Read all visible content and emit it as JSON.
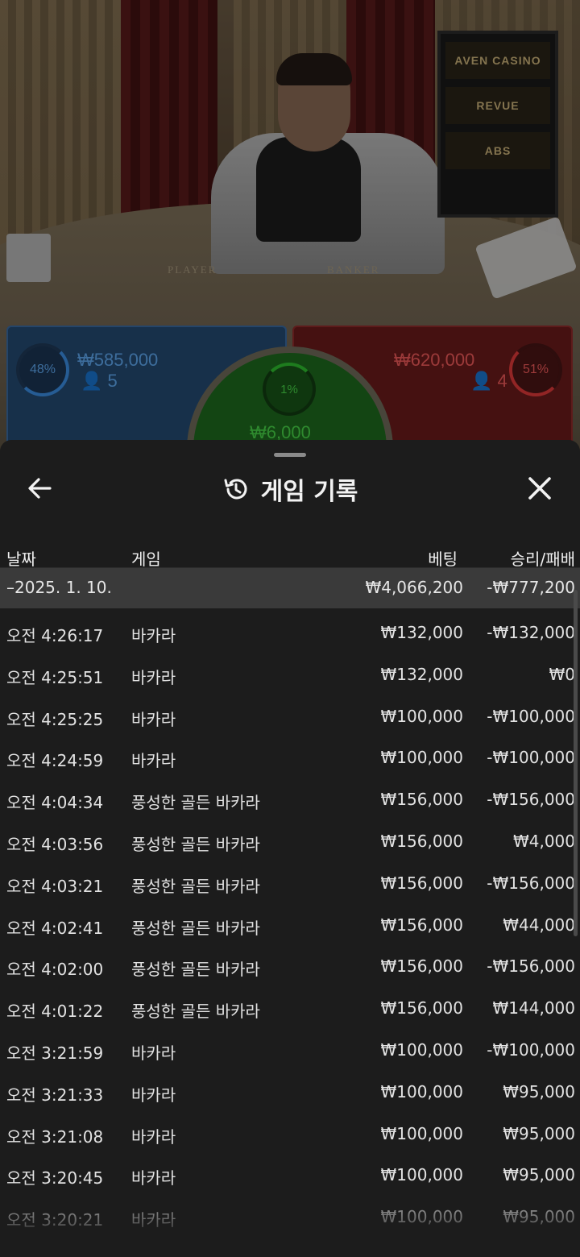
{
  "video": {
    "sponsors": [
      "AVEN CASINO",
      "REVUE",
      "ABS"
    ],
    "table_labels": {
      "player": "PLAYER",
      "banker": "BANKER"
    }
  },
  "bets": {
    "player": {
      "percent": "48%",
      "amount": "₩585,000",
      "players": "5",
      "color": "#3b8ee3"
    },
    "banker": {
      "percent": "51%",
      "amount": "₩620,000",
      "players": "4",
      "color": "#e03a3a"
    },
    "tie": {
      "percent": "1%",
      "amount": "₩6,000",
      "color": "#2fbf2f"
    }
  },
  "history": {
    "title": "게임 기록",
    "icons": {
      "back": "arrow-left-icon",
      "title": "history-icon",
      "close": "close-icon"
    },
    "columns": {
      "date": "날짜",
      "game": "게임",
      "bet": "베팅",
      "result": "승리/패배"
    },
    "day": {
      "label": "–2025. 1. 10.",
      "bet": "₩4,066,200",
      "result": "-₩777,200"
    },
    "rows": [
      {
        "time": "오전 4:26:17",
        "game": "바카라",
        "bet": "₩132,000",
        "result": "-₩132,000"
      },
      {
        "time": "오전 4:25:51",
        "game": "바카라",
        "bet": "₩132,000",
        "result": "₩0"
      },
      {
        "time": "오전 4:25:25",
        "game": "바카라",
        "bet": "₩100,000",
        "result": "-₩100,000"
      },
      {
        "time": "오전 4:24:59",
        "game": "바카라",
        "bet": "₩100,000",
        "result": "-₩100,000"
      },
      {
        "time": "오전 4:04:34",
        "game": "풍성한 골든 바카라",
        "bet": "₩156,000",
        "result": "-₩156,000"
      },
      {
        "time": "오전 4:03:56",
        "game": "풍성한 골든 바카라",
        "bet": "₩156,000",
        "result": "₩4,000"
      },
      {
        "time": "오전 4:03:21",
        "game": "풍성한 골든 바카라",
        "bet": "₩156,000",
        "result": "-₩156,000"
      },
      {
        "time": "오전 4:02:41",
        "game": "풍성한 골든 바카라",
        "bet": "₩156,000",
        "result": "₩44,000"
      },
      {
        "time": "오전 4:02:00",
        "game": "풍성한 골든 바카라",
        "bet": "₩156,000",
        "result": "-₩156,000"
      },
      {
        "time": "오전 4:01:22",
        "game": "풍성한 골든 바카라",
        "bet": "₩156,000",
        "result": "₩144,000"
      },
      {
        "time": "오전 3:21:59",
        "game": "바카라",
        "bet": "₩100,000",
        "result": "-₩100,000"
      },
      {
        "time": "오전 3:21:33",
        "game": "바카라",
        "bet": "₩100,000",
        "result": "₩95,000"
      },
      {
        "time": "오전 3:21:08",
        "game": "바카라",
        "bet": "₩100,000",
        "result": "₩95,000"
      },
      {
        "time": "오전 3:20:45",
        "game": "바카라",
        "bet": "₩100,000",
        "result": "₩95,000"
      },
      {
        "time": "오전 3:20:21",
        "game": "바카라",
        "bet": "₩100,000",
        "result": "₩95,000"
      }
    ]
  }
}
